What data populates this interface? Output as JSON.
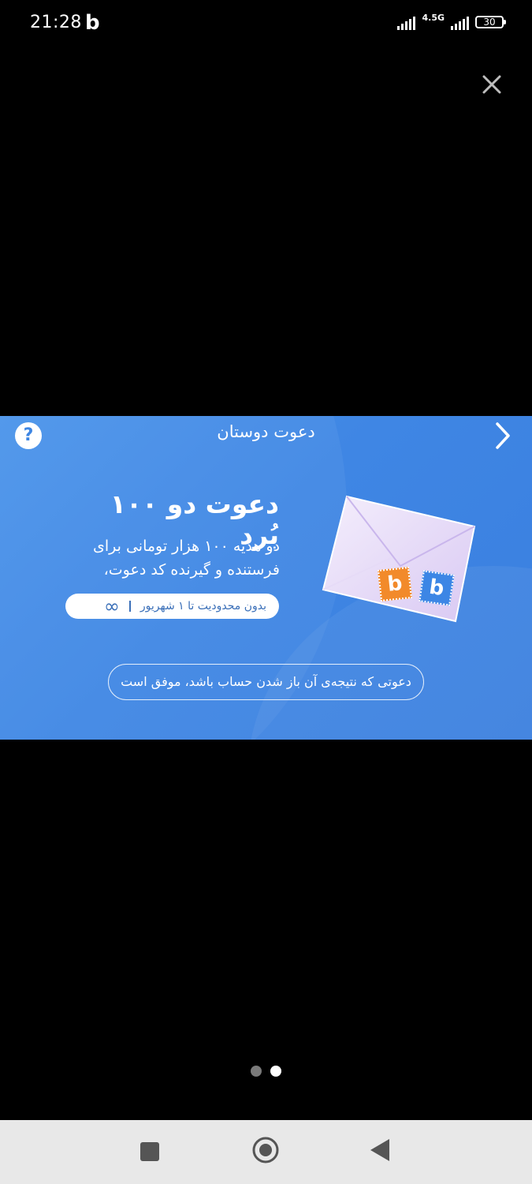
{
  "status_bar": {
    "time": "21:28",
    "app_icon": "b",
    "network": "4.5G",
    "battery": "30"
  },
  "banner": {
    "title": "دعوت دوستان",
    "help": "?",
    "headline": "دعوت دو ۱۰۰ بُرد",
    "subtext_line1": "دو هدیه ۱۰۰ هزار تومانی برای",
    "subtext_line2": "فرستنده و گیرنده کد دعوت،",
    "limit_text": "بدون محدودیت تا ۱ شهریور",
    "infinity_symbol": "∞",
    "stamp_letter": "b",
    "note": "دعوتی که نتیجه‌ی آن باز شدن حساب باشد، موفق است",
    "colors": {
      "background": "#3f86e4",
      "stamp_orange": "#f28a2a",
      "stamp_blue": "#3c86e5"
    }
  },
  "pager": {
    "total": 2,
    "active_index": 1
  },
  "nav": {
    "icons": [
      "square-recents-icon",
      "circle-home-icon",
      "triangle-back-icon"
    ]
  }
}
